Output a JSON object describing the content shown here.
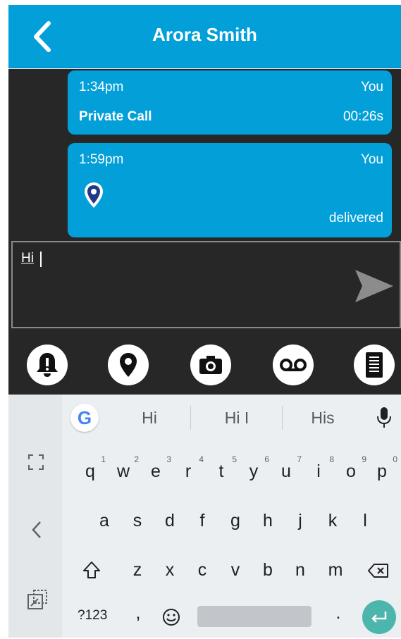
{
  "header": {
    "title": "Arora Smith",
    "back_icon": "chevron-left-icon"
  },
  "messages": [
    {
      "time": "1:34pm",
      "sender": "You",
      "type_label": "Private Call",
      "duration": "00:26s"
    },
    {
      "time": "1:59pm",
      "sender": "You",
      "icon": "location-pin-icon",
      "status": "delivered"
    }
  ],
  "compose": {
    "value": "Hi",
    "send_icon": "send-arrow-icon"
  },
  "actions": [
    {
      "name": "alert-bell-icon"
    },
    {
      "name": "location-pin-icon"
    },
    {
      "name": "camera-icon"
    },
    {
      "name": "voicemail-icon"
    },
    {
      "name": "document-icon"
    }
  ],
  "keyboard": {
    "suggestions": [
      "Hi",
      "Hi I",
      "His"
    ],
    "row1": [
      "q",
      "w",
      "e",
      "r",
      "t",
      "y",
      "u",
      "i",
      "o",
      "p"
    ],
    "row1_hints": [
      "1",
      "2",
      "3",
      "4",
      "5",
      "6",
      "7",
      "8",
      "9",
      "0"
    ],
    "row2": [
      "a",
      "s",
      "d",
      "f",
      "g",
      "h",
      "j",
      "k",
      "l"
    ],
    "row3": [
      "z",
      "x",
      "c",
      "v",
      "b",
      "n",
      "m"
    ],
    "symbols_label": "?123",
    "comma": ",",
    "period": "."
  },
  "colors": {
    "accent": "#029fd9",
    "dark_bg": "#272727",
    "enter_key": "#4db6ac"
  }
}
